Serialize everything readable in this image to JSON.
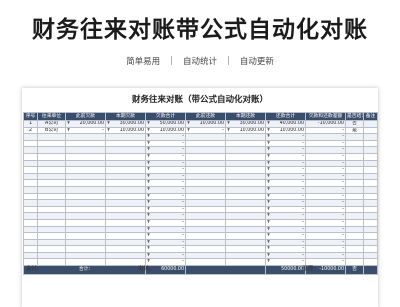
{
  "title": "财务往来对账带公式自动化对账",
  "taglines": [
    "简单易用",
    "自动统计",
    "自动更新"
  ],
  "sheet": {
    "title": "财务往来对账（带公式自动化对账）",
    "headers": [
      "序号",
      "往来单位",
      "此前欠款",
      "本期欠款",
      "欠款合计",
      "此前还款",
      "本期还款",
      "还款合计",
      "欠款和还款差额",
      "是否结清",
      "备注"
    ],
    "currency": "¥",
    "dash": "-",
    "rows": [
      {
        "no": "1",
        "unit": "A公司",
        "prev_owed": "20,000.00",
        "cur_owed": "30,000.00",
        "owed_total": "50,000.00",
        "prev_paid": "10,000.00",
        "cur_paid": "30,000.00",
        "paid_total": "40,000.00",
        "diff": "-10,000.00",
        "settled": "否",
        "note": ""
      },
      {
        "no": "2",
        "unit": "B公司",
        "prev_owed": "-",
        "cur_owed": "10,000.00",
        "owed_total": "10,000.00",
        "prev_paid": "-",
        "cur_paid": "10,000.00",
        "paid_total": "10,000.00",
        "diff": "-",
        "settled": "是",
        "note": ""
      }
    ],
    "empty_row_count": 20,
    "total": {
      "label": "合计:",
      "owed_total": "60000.00",
      "paid_total": "50000.00",
      "diff": "-10000.00",
      "settled": "否"
    },
    "signatures": {
      "accountant": "会计:",
      "cashier": "出纳:",
      "manager": "经理:"
    }
  }
}
